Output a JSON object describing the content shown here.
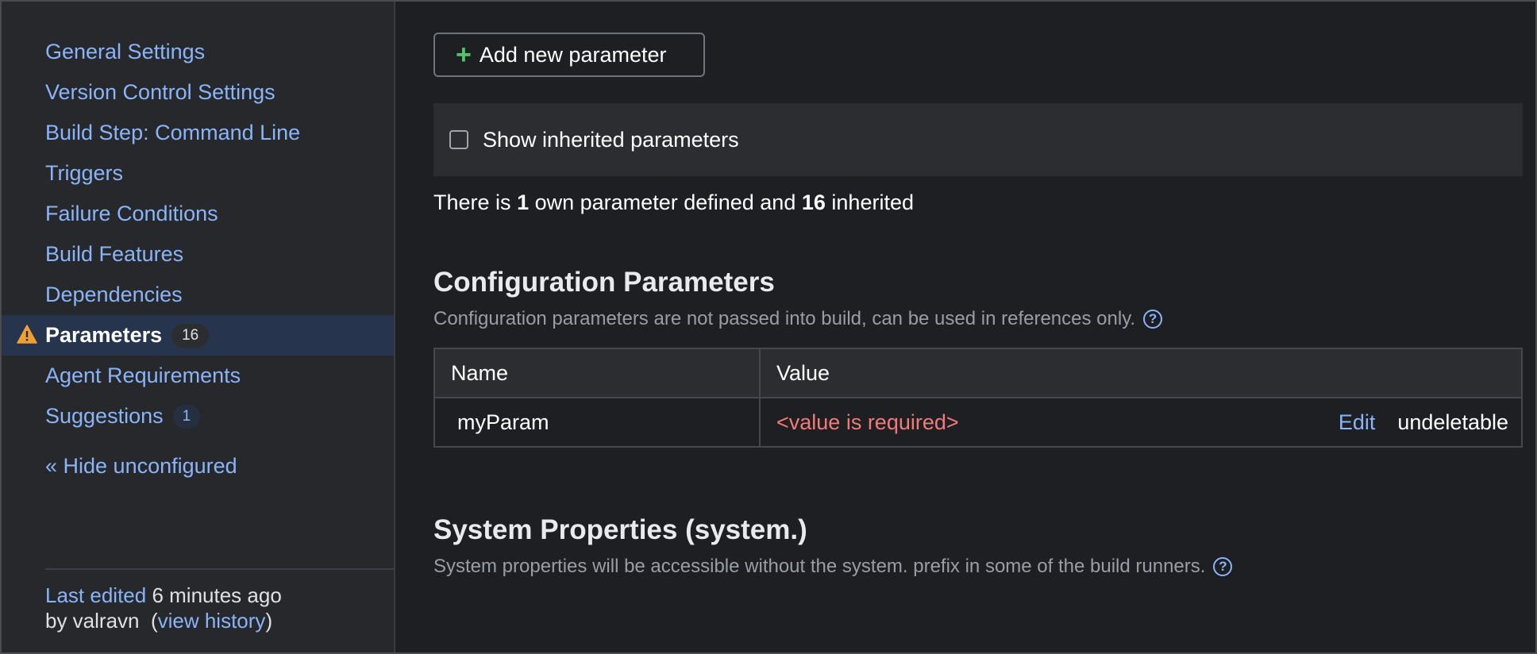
{
  "sidebar": {
    "items": [
      {
        "label": "General Settings"
      },
      {
        "label": "Version Control Settings"
      },
      {
        "label": "Build Step: Command Line"
      },
      {
        "label": "Triggers"
      },
      {
        "label": "Failure Conditions"
      },
      {
        "label": "Build Features"
      },
      {
        "label": "Dependencies"
      },
      {
        "label": "Parameters",
        "badge": "16",
        "active": true,
        "warning": true
      },
      {
        "label": "Agent Requirements"
      },
      {
        "label": "Suggestions",
        "badge": "1"
      }
    ],
    "hide_unconfigured": "« Hide unconfigured",
    "last_edited": {
      "link": "Last edited",
      "time": "6 minutes ago",
      "by": "by valravn",
      "history_link": "view history"
    }
  },
  "main": {
    "add_button": "Add new parameter",
    "show_inherited": "Show inherited parameters",
    "summary": {
      "prefix": "There is",
      "own_count": "1",
      "middle": "own parameter defined and",
      "inherited_count": "16",
      "suffix": "inherited"
    },
    "config_section": {
      "title": "Configuration Parameters",
      "description": "Configuration parameters are not passed into build, can be used in references only."
    },
    "table": {
      "columns": [
        "Name",
        "Value"
      ],
      "rows": [
        {
          "name": "myParam",
          "value": "<value is required>",
          "edit": "Edit",
          "delete_status": "undeletable"
        }
      ]
    },
    "system_section": {
      "title": "System Properties (system.)",
      "description": "System properties will be accessible without the system. prefix in some of the build runners."
    }
  },
  "colors": {
    "link": "#8ab4f8",
    "warning": "#f0a030",
    "error_value": "#f07b78",
    "add_plus": "#57c26c",
    "active_item_bg": "#26344d"
  },
  "icons": {
    "warning": "warning-triangle-icon",
    "plus": "plus-icon",
    "help": "help-circle-icon"
  }
}
